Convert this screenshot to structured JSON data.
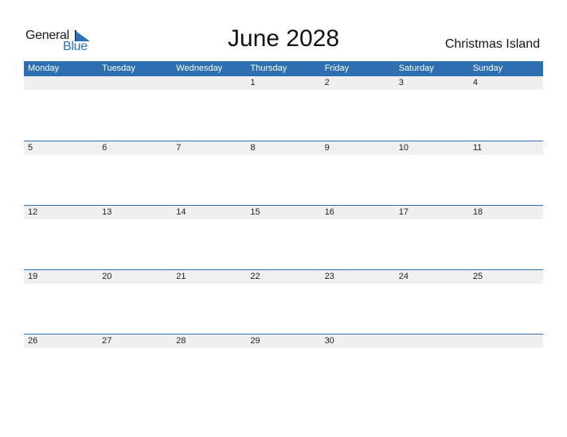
{
  "logo": {
    "general": "General",
    "blue": "Blue"
  },
  "title": "June 2028",
  "country": "Christmas Island",
  "accent_color": "#2d6fb0",
  "weekdays": [
    "Monday",
    "Tuesday",
    "Wednesday",
    "Thursday",
    "Friday",
    "Saturday",
    "Sunday"
  ],
  "weeks": [
    [
      "",
      "",
      "",
      "1",
      "2",
      "3",
      "4"
    ],
    [
      "5",
      "6",
      "7",
      "8",
      "9",
      "10",
      "11"
    ],
    [
      "12",
      "13",
      "14",
      "15",
      "16",
      "17",
      "18"
    ],
    [
      "19",
      "20",
      "21",
      "22",
      "23",
      "24",
      "25"
    ],
    [
      "26",
      "27",
      "28",
      "29",
      "30",
      "",
      ""
    ]
  ]
}
